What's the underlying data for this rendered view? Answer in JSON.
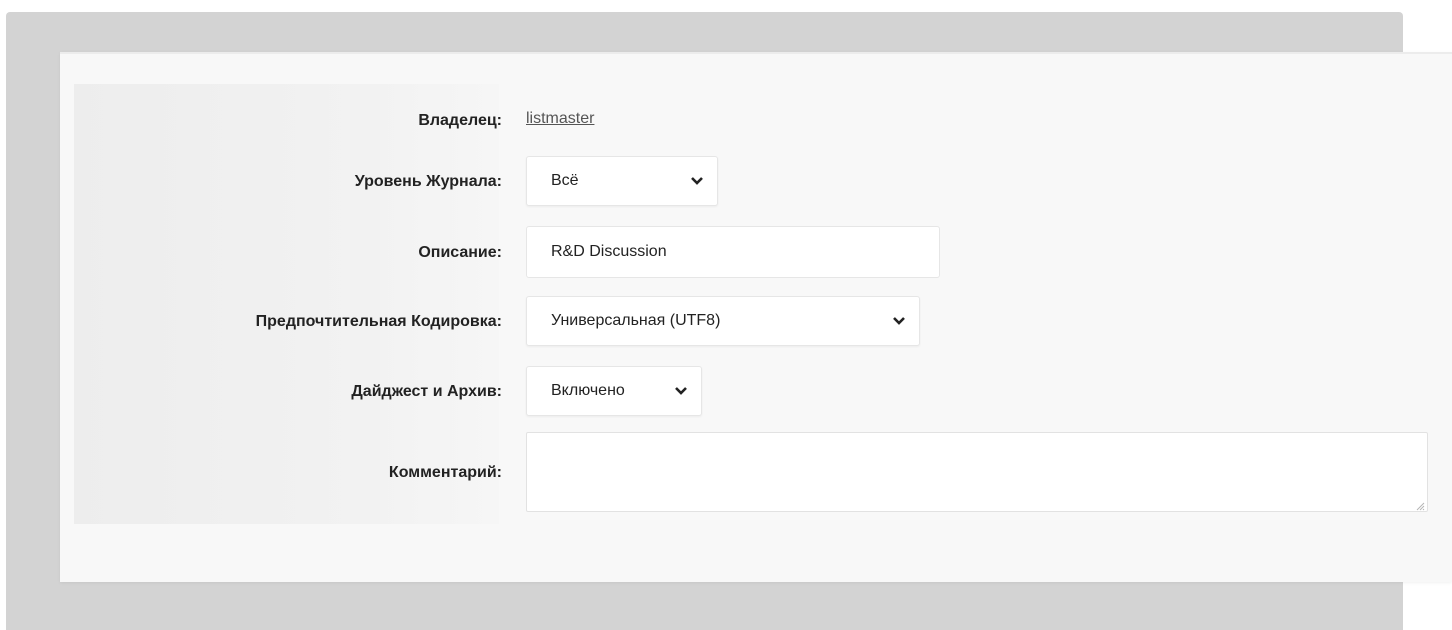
{
  "form": {
    "owner": {
      "label": "Владелец:",
      "value": "listmaster"
    },
    "log_level": {
      "label": "Уровень Журнала:",
      "selected": "Всё"
    },
    "description": {
      "label": "Описание:",
      "value": "R&D Discussion"
    },
    "encoding": {
      "label": "Предпочтительная Кодировка:",
      "selected": "Универсальная (UTF8)"
    },
    "digest": {
      "label": "Дайджест и Архив:",
      "selected": "Включено"
    },
    "comment": {
      "label": "Комментарий:",
      "value": ""
    }
  },
  "icons": {
    "dropdown": "chevron-down-icon",
    "resize": "resize-grip-icon"
  },
  "colors": {
    "backdrop": "#d3d3d3",
    "panel": "#f8f8f8",
    "link": "#555555"
  }
}
